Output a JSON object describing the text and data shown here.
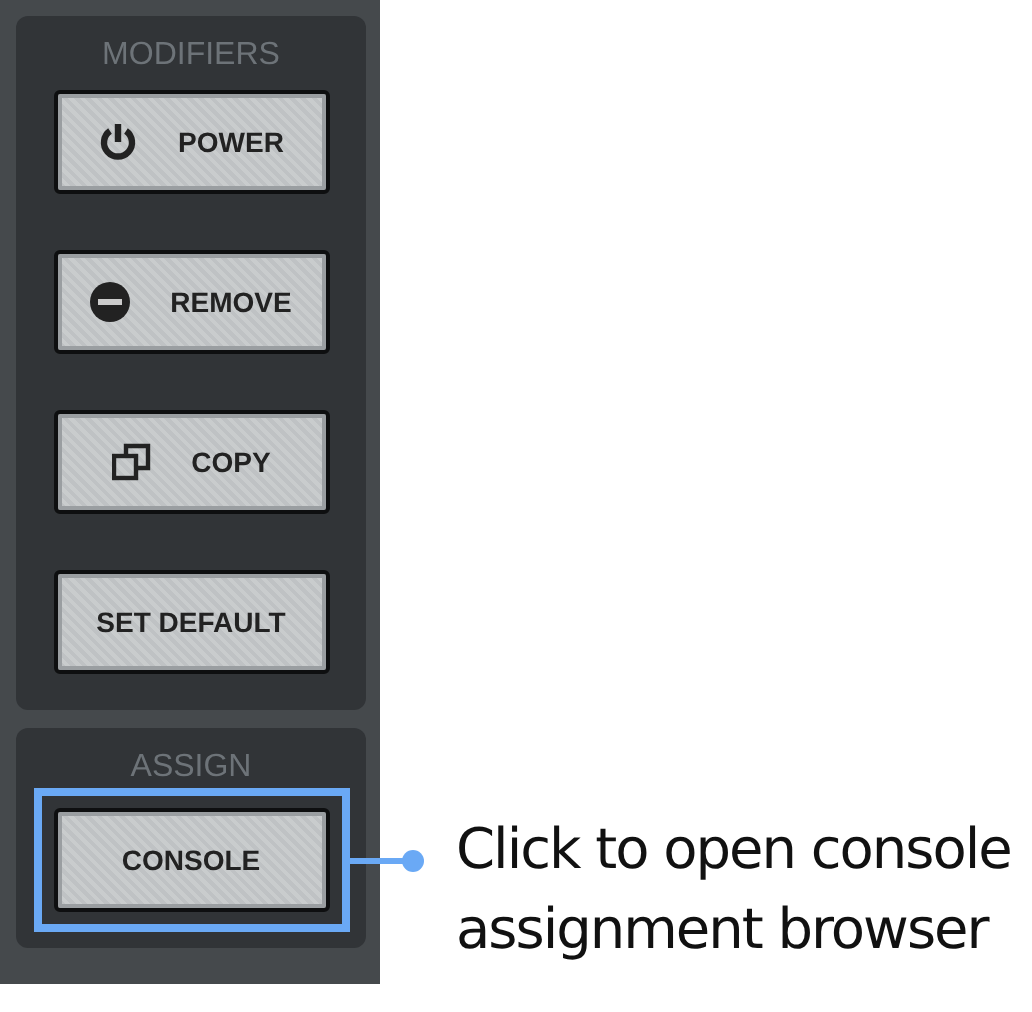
{
  "sections": [
    {
      "title": "MODIFIERS",
      "highlighted": false,
      "buttons": [
        {
          "label": "POWER",
          "kind": "power"
        },
        {
          "label": "REMOVE",
          "kind": "remove"
        },
        {
          "label": "COPY",
          "kind": "copy"
        },
        {
          "label": "SET DEFAULT",
          "kind": "plain"
        }
      ]
    },
    {
      "title": "ASSIGN",
      "highlighted": true,
      "buttons": [
        {
          "label": "CONSOLE",
          "kind": "plain"
        }
      ]
    }
  ],
  "callout": {
    "text": "Click to open console assignment browser"
  }
}
